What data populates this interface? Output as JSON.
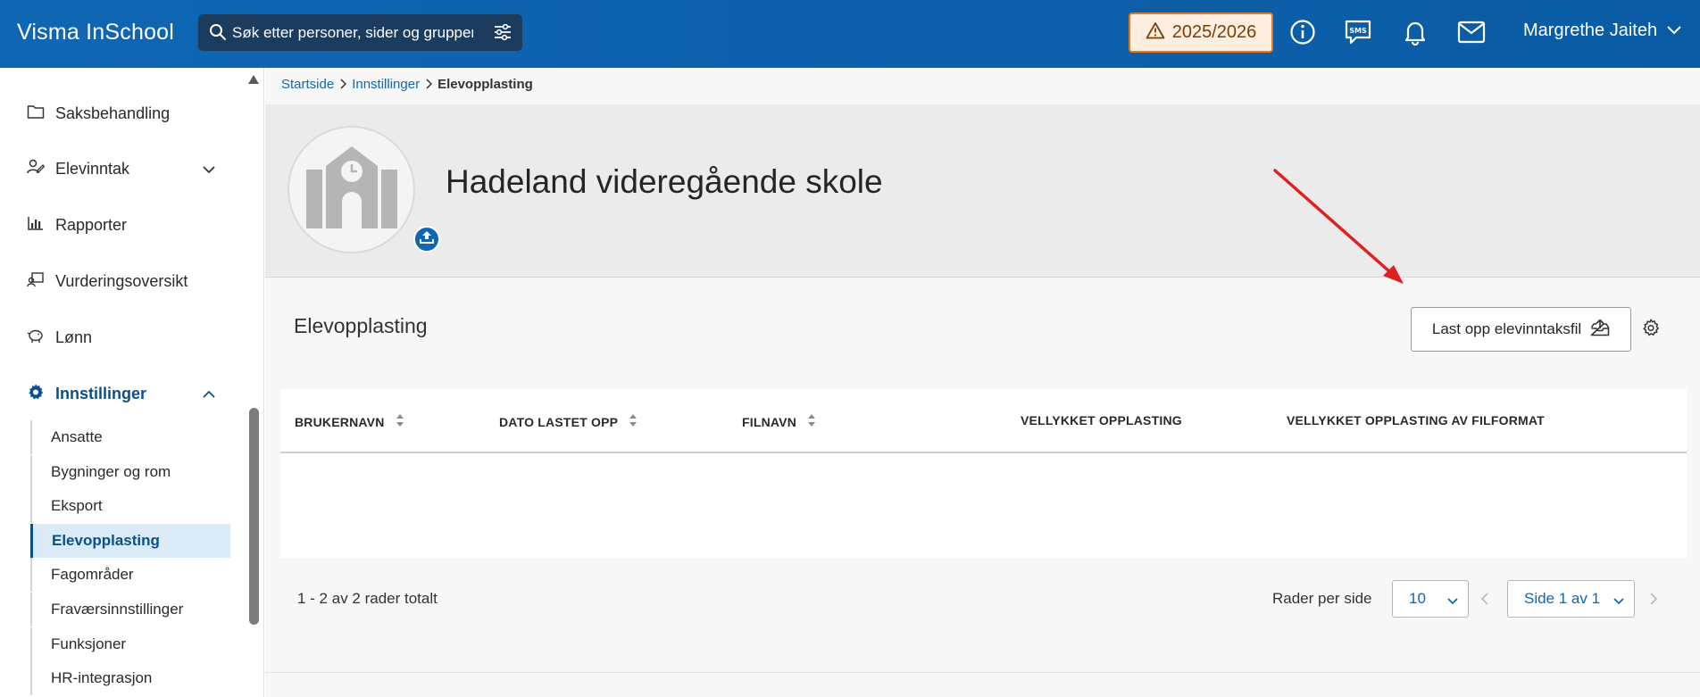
{
  "topbar": {
    "app_title": "Visma InSchool",
    "search_placeholder": "Søk etter personer, sider og grupper",
    "year_badge": "2025/2026",
    "user_name": "Margrethe Jaiteh"
  },
  "sidebar": {
    "items": [
      {
        "label": "Saksbehandling",
        "icon": "folder-icon"
      },
      {
        "label": "Elevinntak",
        "icon": "user-edit-icon"
      },
      {
        "label": "Rapporter",
        "icon": "bar-chart-icon"
      },
      {
        "label": "Vurderingsoversikt",
        "icon": "assessment-icon"
      },
      {
        "label": "Lønn",
        "icon": "piggy-bank-icon"
      },
      {
        "label": "Innstillinger",
        "icon": "gear-icon"
      }
    ],
    "sub_items": [
      {
        "label": "Ansatte"
      },
      {
        "label": "Bygninger og rom"
      },
      {
        "label": "Eksport"
      },
      {
        "label": "Elevopplasting",
        "active": true
      },
      {
        "label": "Fagområder"
      },
      {
        "label": "Fraværsinnstillinger"
      },
      {
        "label": "Funksjoner"
      },
      {
        "label": "HR-integrasjon"
      }
    ]
  },
  "breadcrumb": {
    "home": "Startside",
    "parent": "Innstillinger",
    "current": "Elevopplasting"
  },
  "header": {
    "school_name": "Hadeland videregående skole"
  },
  "section": {
    "title": "Elevopplasting",
    "upload_button": "Last opp elevinntaksfil"
  },
  "table": {
    "columns": [
      {
        "label": "BRUKERNAVN",
        "sortable": true
      },
      {
        "label": "DATO LASTET OPP",
        "sortable": true
      },
      {
        "label": "FILNAVN",
        "sortable": true
      },
      {
        "label": "VELLYKKET OPPLASTING",
        "sortable": false
      },
      {
        "label": "VELLYKKET OPPLASTING AV FILFORMAT",
        "sortable": false
      }
    ]
  },
  "pagination": {
    "rows_total": "1 - 2 av 2 rader totalt",
    "rows_per_page_label": "Rader per side",
    "rows_per_page_value": "10",
    "page_value": "Side 1 av 1"
  },
  "colors": {
    "brand": "#0f66b3",
    "warning_border": "#e07a1f",
    "active_nav": "#0b4f8c",
    "annotation_arrow": "#e02020"
  }
}
